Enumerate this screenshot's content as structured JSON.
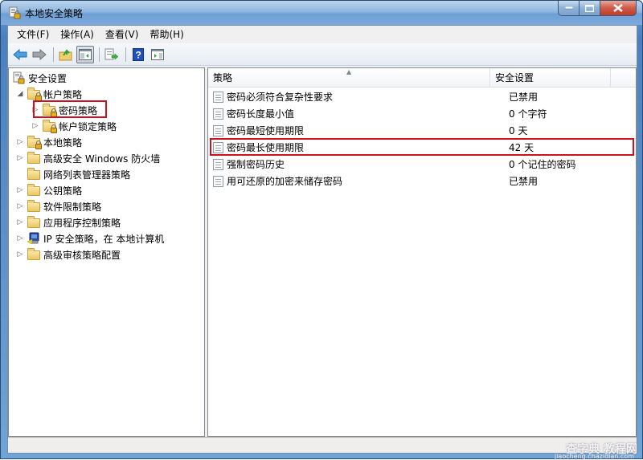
{
  "window": {
    "title": "本地安全策略",
    "controls": {
      "minimize": "—",
      "maximize": "□",
      "close": "✕"
    }
  },
  "menu": [
    {
      "label": "文件(F)"
    },
    {
      "label": "操作(A)"
    },
    {
      "label": "查看(V)"
    },
    {
      "label": "帮助(H)"
    }
  ],
  "toolbar": {
    "buttons": [
      {
        "name": "back-button",
        "icon": "back-arrow-icon"
      },
      {
        "name": "forward-button",
        "icon": "forward-arrow-icon"
      },
      {
        "name": "up-level-button",
        "icon": "folder-up-icon"
      },
      {
        "name": "show-hide-tree-button",
        "icon": "console-tree-icon",
        "pressed": true
      },
      {
        "name": "export-list-button",
        "icon": "export-list-icon"
      },
      {
        "name": "help-button",
        "icon": "help-icon"
      },
      {
        "name": "show-action-pane-button",
        "icon": "action-pane-icon"
      }
    ]
  },
  "tree": {
    "root": {
      "label": "安全设置",
      "icon": "security-settings-icon"
    },
    "items": [
      {
        "label": "帐户策略",
        "level": 1,
        "expander": "expanded",
        "icon": "locked-folder-icon"
      },
      {
        "label": "密码策略",
        "level": 2,
        "expander": "collapsed",
        "icon": "locked-folder-icon",
        "selected": true
      },
      {
        "label": "帐户锁定策略",
        "level": 2,
        "expander": "collapsed",
        "icon": "locked-folder-icon"
      },
      {
        "label": "本地策略",
        "level": 1,
        "expander": "collapsed",
        "icon": "locked-folder-icon"
      },
      {
        "label": "高级安全 Windows 防火墙",
        "level": 1,
        "expander": "collapsed",
        "icon": "folder-icon"
      },
      {
        "label": "网络列表管理器策略",
        "level": 1,
        "expander": "none",
        "icon": "folder-icon"
      },
      {
        "label": "公钥策略",
        "level": 1,
        "expander": "collapsed",
        "icon": "folder-icon"
      },
      {
        "label": "软件限制策略",
        "level": 1,
        "expander": "collapsed",
        "icon": "folder-icon"
      },
      {
        "label": "应用程序控制策略",
        "level": 1,
        "expander": "collapsed",
        "icon": "folder-icon"
      },
      {
        "label": "IP 安全策略，在 本地计算机",
        "level": 1,
        "expander": "collapsed",
        "icon": "ip-security-icon"
      },
      {
        "label": "高级审核策略配置",
        "level": 1,
        "expander": "collapsed",
        "icon": "folder-icon"
      }
    ]
  },
  "list": {
    "columns": [
      {
        "label": "策略",
        "sorted": "ascending"
      },
      {
        "label": "安全设置"
      }
    ],
    "rows": [
      {
        "policy": "密码必须符合复杂性要求",
        "setting": "已禁用"
      },
      {
        "policy": "密码长度最小值",
        "setting": "0 个字符"
      },
      {
        "policy": "密码最短使用期限",
        "setting": "0 天"
      },
      {
        "policy": "密码最长使用期限",
        "setting": "42 天",
        "highlighted": true
      },
      {
        "policy": "强制密码历史",
        "setting": "0 个记住的密码"
      },
      {
        "policy": "用可还原的加密来储存密码",
        "setting": "已禁用"
      }
    ]
  },
  "watermark": {
    "main": "查字典 教程网",
    "sub": "jiaocheng.chazidian.com"
  },
  "colors": {
    "highlight_border": "#d0101c",
    "titlebar": "#7eaade"
  }
}
